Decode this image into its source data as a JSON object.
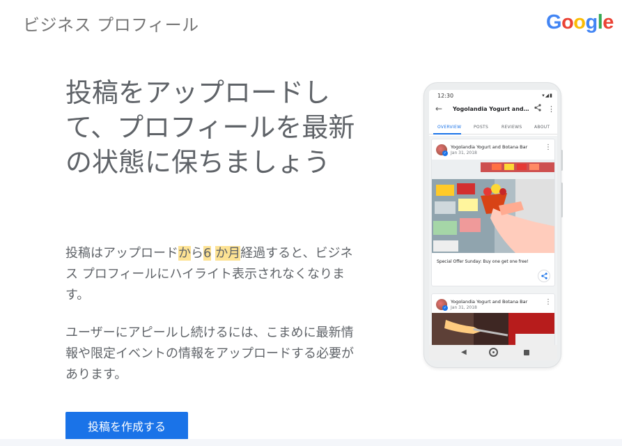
{
  "header": {
    "app_title": "ビジネス プロフィール",
    "logo_letters": [
      {
        "char": "G",
        "color": "#4285f4"
      },
      {
        "char": "o",
        "color": "#ea4335"
      },
      {
        "char": "o",
        "color": "#fbbc05"
      },
      {
        "char": "g",
        "color": "#4285f4"
      },
      {
        "char": "l",
        "color": "#34a853"
      },
      {
        "char": "e",
        "color": "#ea4335"
      }
    ]
  },
  "main": {
    "headline": "投稿をアップロードして、プロフィールを最新の状態に保ちましょう",
    "paragraph1": {
      "part1": "投稿はアップロード",
      "highlight1": "か",
      "part2": "ら",
      "highlight2": "6",
      "part3": " ",
      "highlight3": "か月",
      "part4": "経過すると、ビジネス プロフィールにハイライト表示されなくなります。"
    },
    "paragraph2": "ユーザーにアピールし続けるには、こまめに最新情報や限定イベントの情報をアップロードする必要があります。",
    "cta_label": "投稿を作成する",
    "highlight_color": "#fde293",
    "button_color": "#1a73e8"
  },
  "phone": {
    "status_time": "12:30",
    "status_icons": "▾◢▮",
    "appbar_title": "Yogolandia Yogurt and Bo...",
    "tabs": [
      {
        "label": "OVERVIEW",
        "active": true
      },
      {
        "label": "POSTS",
        "active": false
      },
      {
        "label": "REVIEWS",
        "active": false
      },
      {
        "label": "ABOUT",
        "active": false
      }
    ],
    "posts": [
      {
        "name": "Yogolandia Yogurt and Botana Bar",
        "date": "Jan 31, 2018",
        "text": "Special Offer Sunday: Buy one get one free!"
      },
      {
        "name": "Yogolandia Yogurt and Botana Bar",
        "date": "Jan 31, 2018"
      }
    ]
  }
}
